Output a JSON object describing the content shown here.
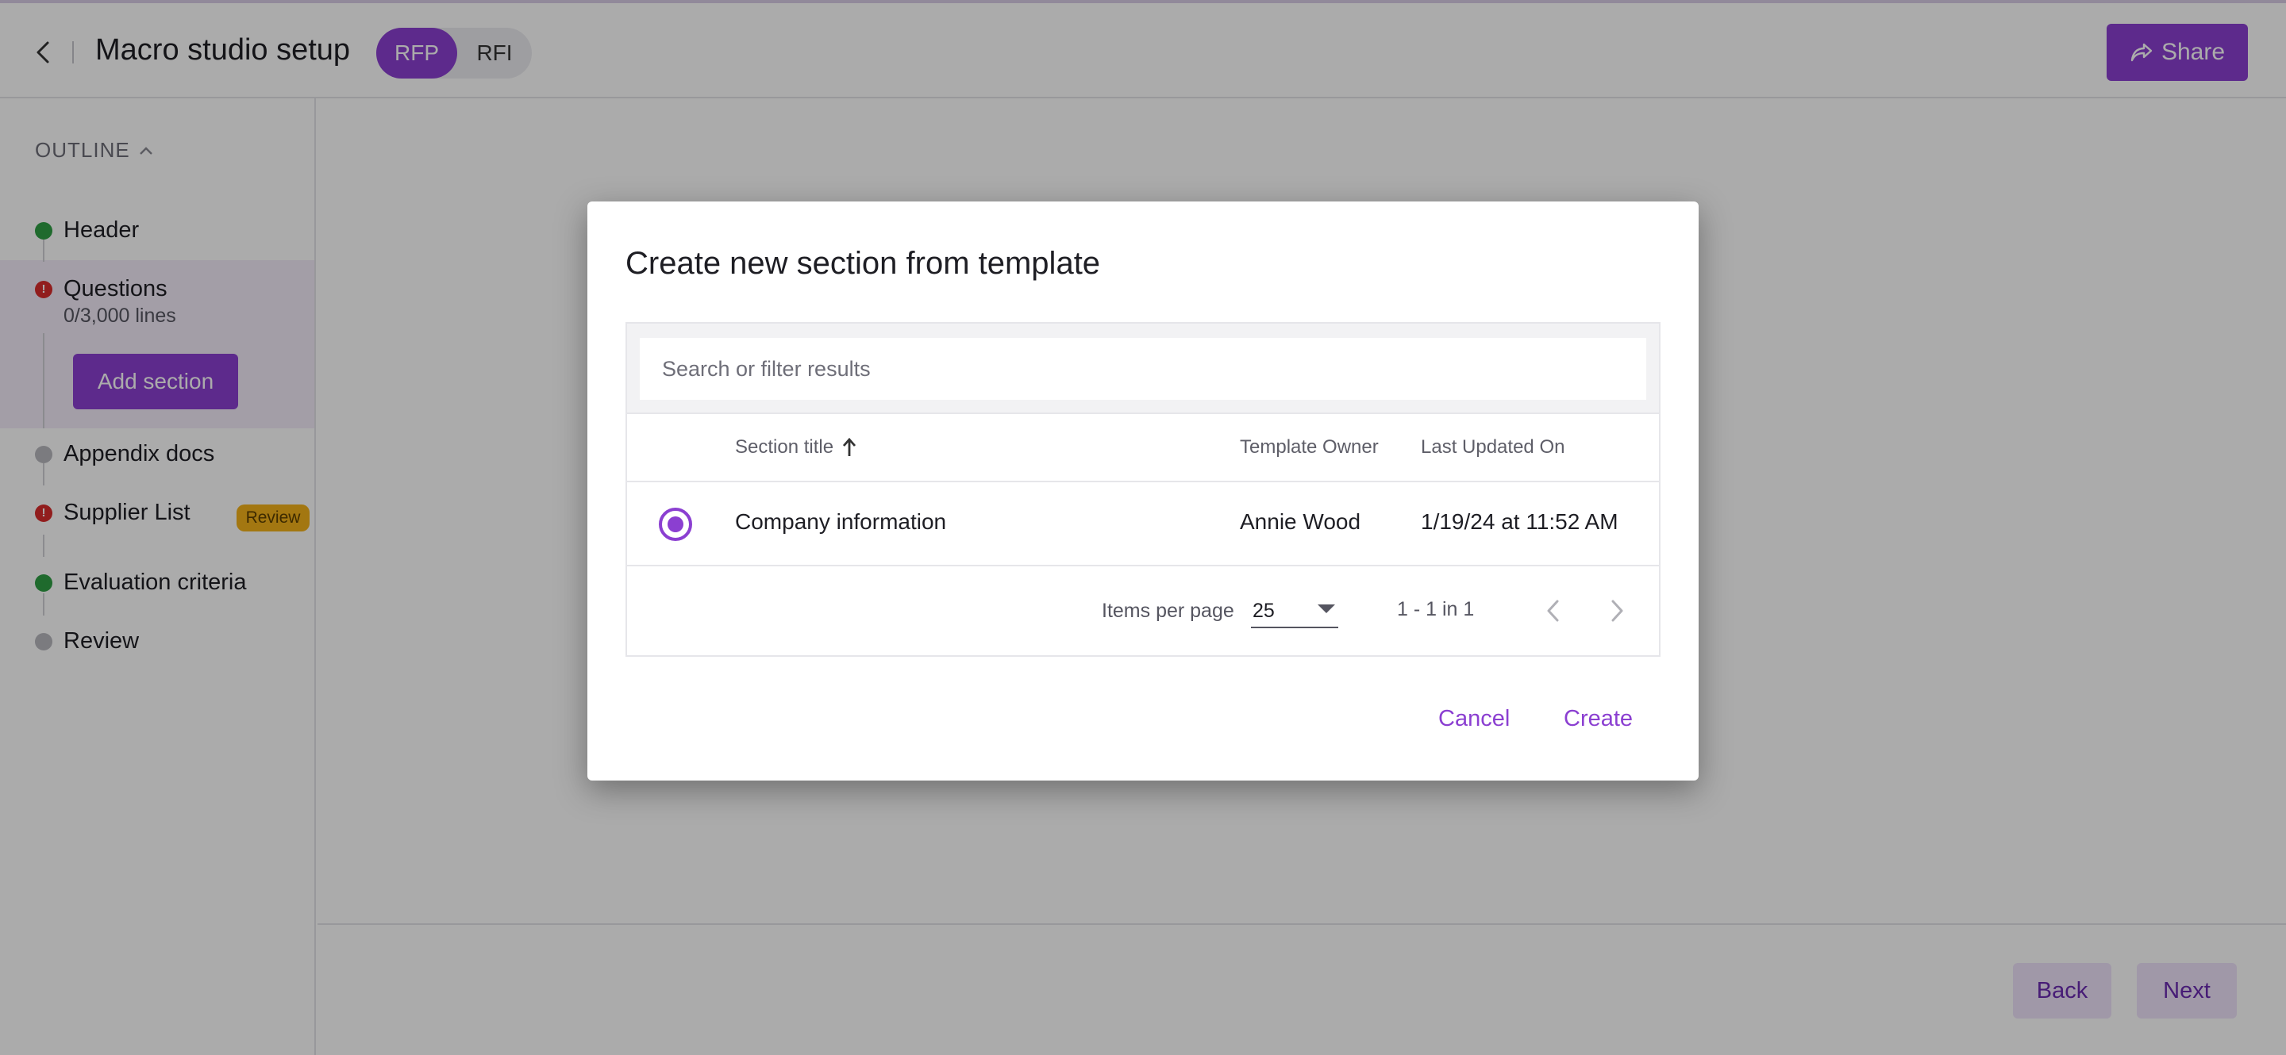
{
  "header": {
    "title": "Macro studio setup",
    "segments": [
      "RFP",
      "RFI"
    ],
    "share_label": "Share"
  },
  "sidebar": {
    "outline_label": "OUTLINE",
    "steps": [
      {
        "label": "Header",
        "status": "complete"
      },
      {
        "label": "Questions",
        "status": "error",
        "sub": "0/3,000 lines"
      },
      {
        "label": "Appendix docs",
        "status": "pending"
      },
      {
        "label": "Supplier List",
        "status": "error",
        "badge": "Review"
      },
      {
        "label": "Evaluation criteria",
        "status": "complete"
      },
      {
        "label": "Review",
        "status": "pending"
      }
    ],
    "add_section_label": "Add section"
  },
  "footer": {
    "back_label": "Back",
    "next_label": "Next"
  },
  "modal": {
    "title": "Create new section from template",
    "search_placeholder": "Search or filter results",
    "columns": [
      "Section title",
      "Template Owner",
      "Last Updated On"
    ],
    "rows": [
      {
        "selected": true,
        "section_title": "Company information",
        "owner": "Annie Wood",
        "updated": "1/19/24 at 11:52 AM"
      }
    ],
    "items_per_page_label": "Items per page",
    "items_per_page_value": "25",
    "range_label": "1 - 1 in 1",
    "cancel_label": "Cancel",
    "create_label": "Create"
  },
  "colors": {
    "accent": "#8b3fd1",
    "success": "#2f9e44",
    "error": "#d92c2c",
    "warning": "#f3b21a"
  }
}
